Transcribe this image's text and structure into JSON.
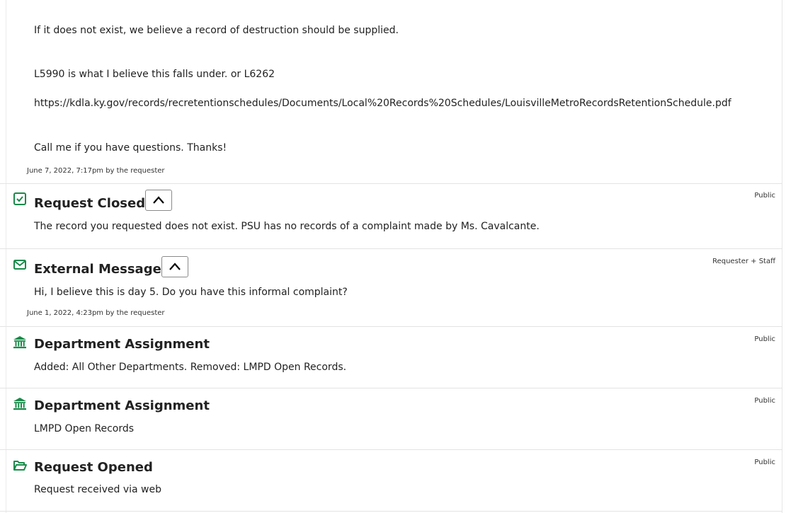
{
  "continued_message": {
    "lines": [
      "If it does not exist, we believe a record of destruction should be supplied.",
      "L5990 is what I believe this falls under. or L6262",
      "https://kdla.ky.gov/records/recretentionschedules/Documents/Local%20Records%20Schedules/LouisvilleMetroRecordsRetentionSchedule.pdf",
      "Call me if you have questions. Thanks!"
    ],
    "meta": "June 7, 2022, 7:17pm by the requester"
  },
  "entries": [
    {
      "icon": "checkbox-checked-icon",
      "title": "Request Closed",
      "visibility": "Public",
      "body": "The record you requested does not exist. PSU has no records of a complaint made by Ms. Cavalcante.",
      "meta": ""
    },
    {
      "icon": "envelope-icon",
      "title": "External Message",
      "visibility": "Requester + Staff",
      "body": "Hi, I believe this is day 5. Do you have this informal complaint?",
      "meta": "June 1, 2022, 4:23pm by the requester"
    },
    {
      "icon": "bank-building-icon",
      "title": "Department Assignment",
      "visibility": "Public",
      "body": "Added: All Other Departments. Removed: LMPD Open Records.",
      "meta": ""
    },
    {
      "icon": "bank-building-icon",
      "title": "Department Assignment",
      "visibility": "Public",
      "body": "LMPD Open Records",
      "meta": ""
    },
    {
      "icon": "folder-open-icon",
      "title": "Request Opened",
      "visibility": "Public",
      "body": "Request received via web",
      "meta": ""
    }
  ],
  "colors": {
    "accent_green": "#1a8a4a",
    "divider": "#e3e3e3"
  }
}
